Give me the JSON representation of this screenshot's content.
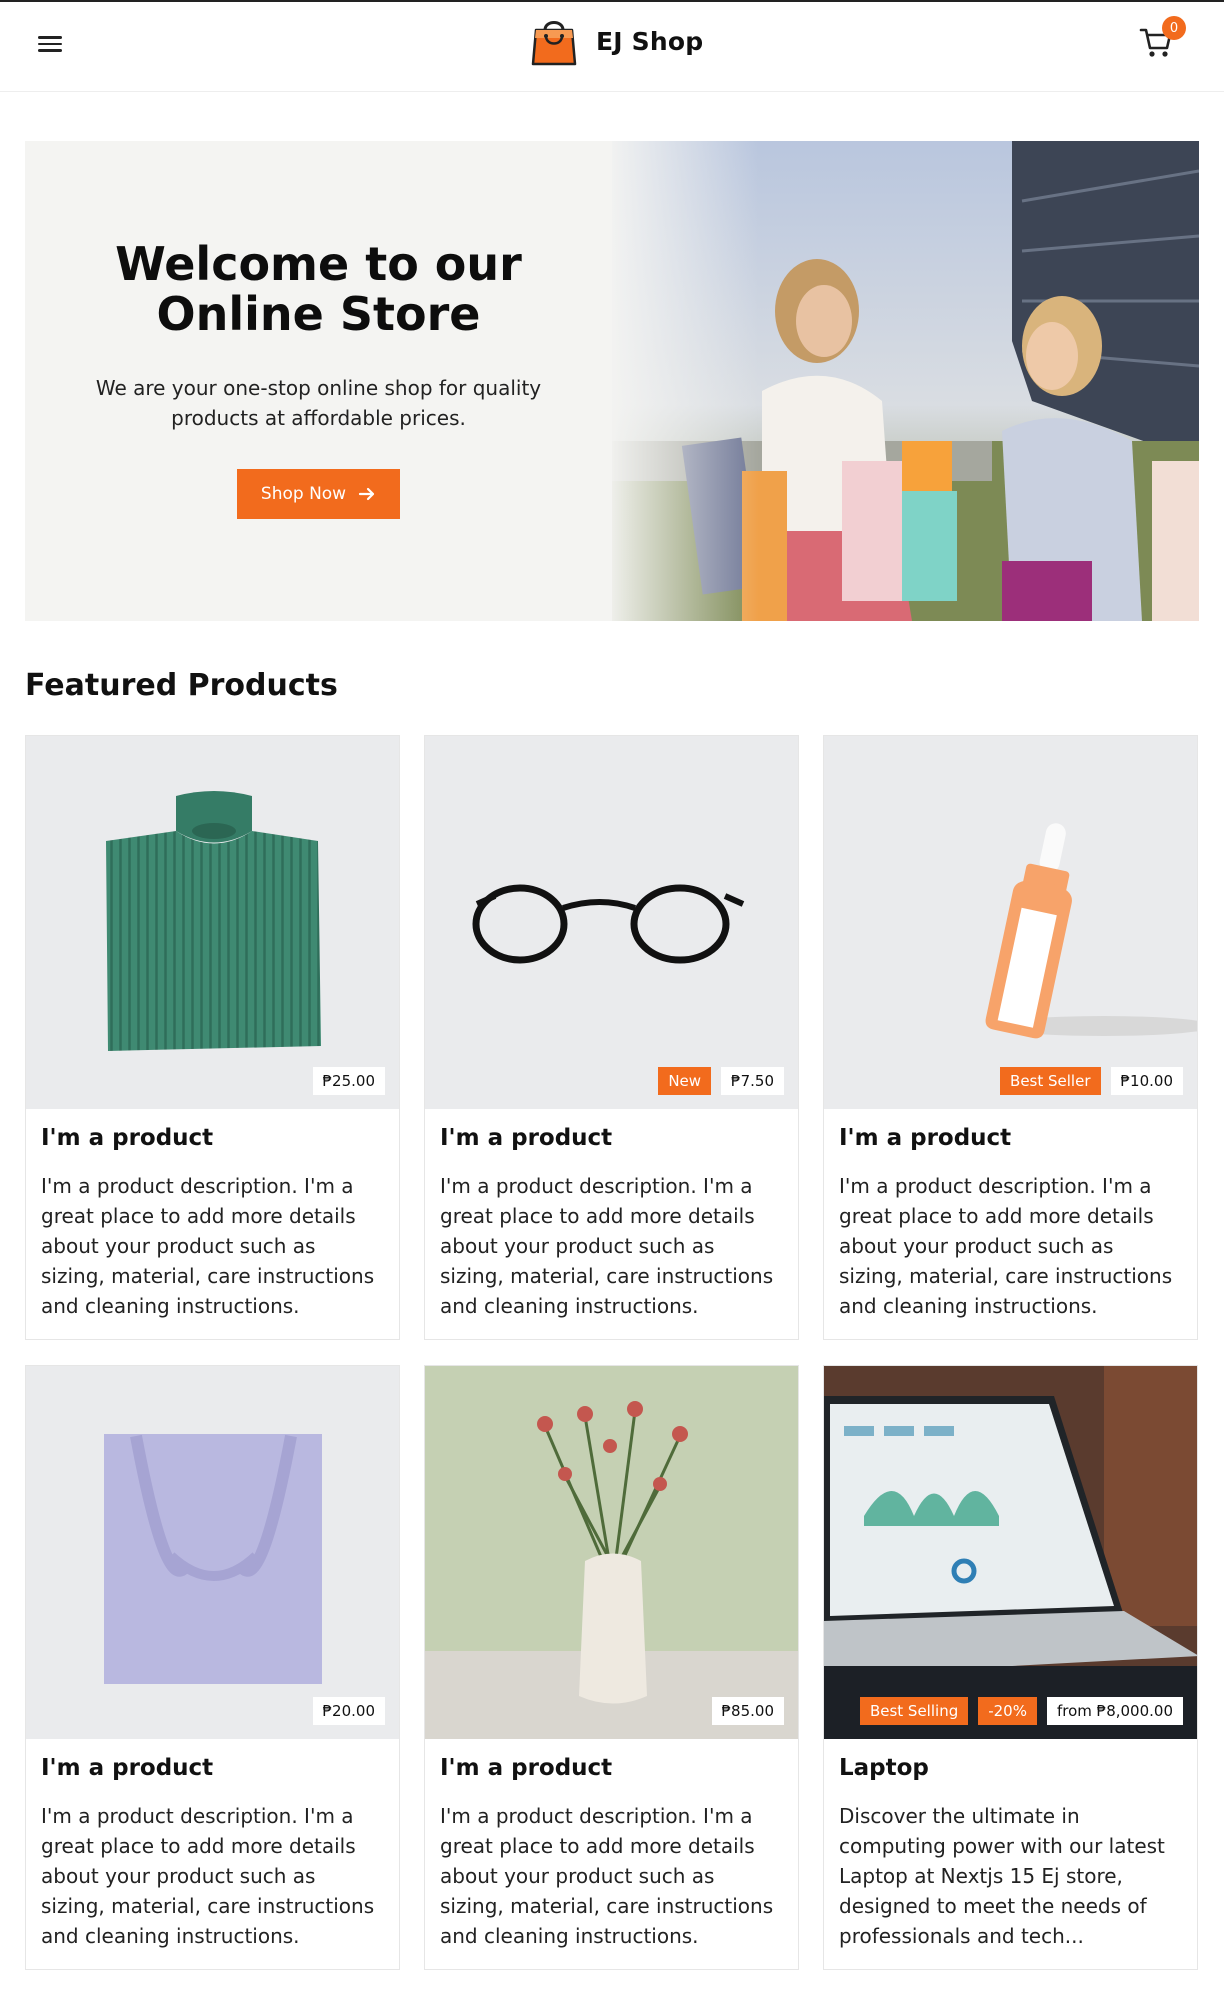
{
  "header": {
    "brand_name": "EJ Shop",
    "cart_count": "0"
  },
  "hero": {
    "title_line1": "Welcome to our",
    "title_line2": "Online Store",
    "subtitle": "We are your one-stop online shop for quality products at affordable prices.",
    "cta_label": "Shop Now"
  },
  "featured": {
    "title": "Featured Products",
    "products": [
      {
        "title": "I'm a product",
        "price": "₱25.00",
        "description": "I'm a product description. I'm a great place to add more details about your product such as sizing, material, care instructions and cleaning instructions."
      },
      {
        "title": "I'm a product",
        "badge": "New",
        "price": "₱7.50",
        "description": "I'm a product description. I'm a great place to add more details about your product such as sizing, material, care instructions and cleaning instructions."
      },
      {
        "title": "I'm a product",
        "badge": "Best Seller",
        "price": "₱10.00",
        "description": "I'm a product description. I'm a great place to add more details about your product such as sizing, material, care instructions and cleaning instructions."
      },
      {
        "title": "I'm a product",
        "price": "₱20.00",
        "description": "I'm a product description. I'm a great place to add more details about your product such as sizing, material, care instructions and cleaning instructions."
      },
      {
        "title": "I'm a product",
        "price": "₱85.00",
        "description": "I'm a product description. I'm a great place to add more details about your product such as sizing, material, care instructions and cleaning instructions."
      },
      {
        "title": "Laptop",
        "badge": "Best Selling",
        "discount": "-20%",
        "price": "from ₱8,000.00",
        "description": "Discover the ultimate in computing power with our latest Laptop at Nextjs 15 Ej store, designed to meet the needs of professionals and tech..."
      }
    ]
  },
  "colors": {
    "accent": "#f26b1d",
    "hero_bg": "#f4f4f2",
    "card_img_bg": "#eaebed"
  }
}
